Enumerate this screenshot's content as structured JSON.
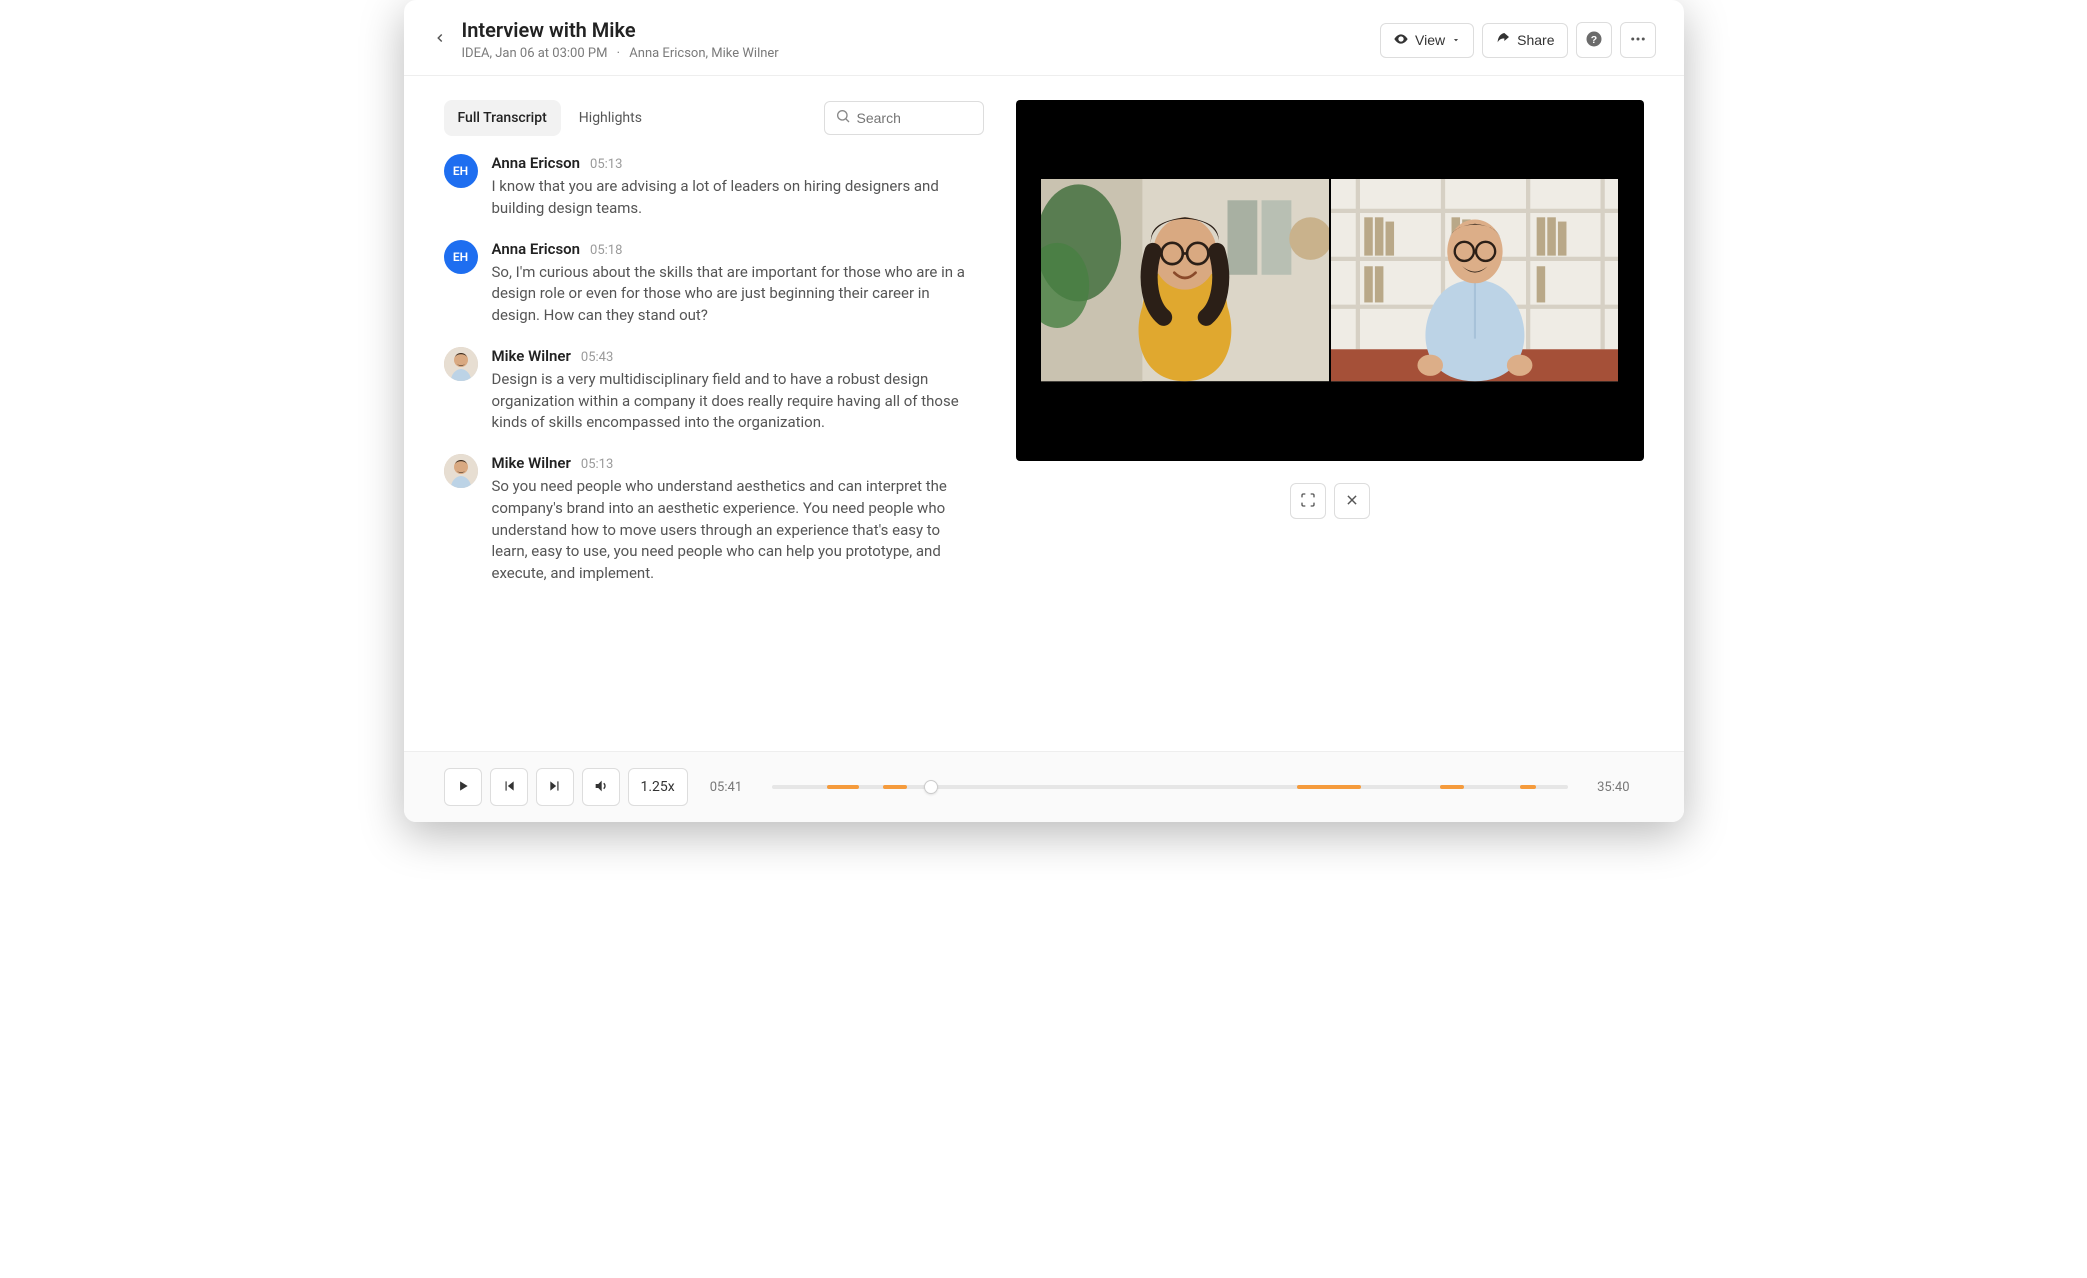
{
  "header": {
    "title": "Interview with Mike",
    "project": "IDEA",
    "datetime": "Jan 06 at 03:00 PM",
    "participants": "Anna Ericson, Mike Wilner",
    "view_label": "View",
    "share_label": "Share"
  },
  "tabs": {
    "full_transcript": "Full Transcript",
    "highlights": "Highlights",
    "active": "full_transcript"
  },
  "search": {
    "placeholder": "Search"
  },
  "avatars": {
    "anna_initials": "EH"
  },
  "transcript": [
    {
      "avatar": "eh",
      "name": "Anna Ericson",
      "ts": "05:13",
      "text": "I know that you are advising a lot of leaders on hiring designers and building design teams."
    },
    {
      "avatar": "eh",
      "name": "Anna Ericson",
      "ts": "05:18",
      "text": "So, I'm curious about the skills that are important for those who are in a design role or even for those who are just beginning their career in design. How can they stand out?"
    },
    {
      "avatar": "mw",
      "name": "Mike Wilner",
      "ts": "05:43",
      "text": "Design is a very multidisciplinary field and to have a robust design organization within a company it does really require having all of those kinds of skills encompassed into the organization."
    },
    {
      "avatar": "mw",
      "name": "Mike Wilner",
      "ts": "05:13",
      "text": "So you need people who understand aesthetics and can interpret the company's brand into an aesthetic experience. You need people who understand how to move users through an experience that's easy to learn, easy to use, you need people who can help you prototype, and execute, and implement."
    }
  ],
  "playback": {
    "speed": "1.25x",
    "current": "05:41",
    "total": "35:40",
    "playhead_pct": 20,
    "highlight_segments": [
      {
        "start_pct": 7,
        "width_pct": 4
      },
      {
        "start_pct": 14,
        "width_pct": 3
      },
      {
        "start_pct": 66,
        "width_pct": 8
      },
      {
        "start_pct": 84,
        "width_pct": 3
      },
      {
        "start_pct": 94,
        "width_pct": 2
      }
    ]
  }
}
